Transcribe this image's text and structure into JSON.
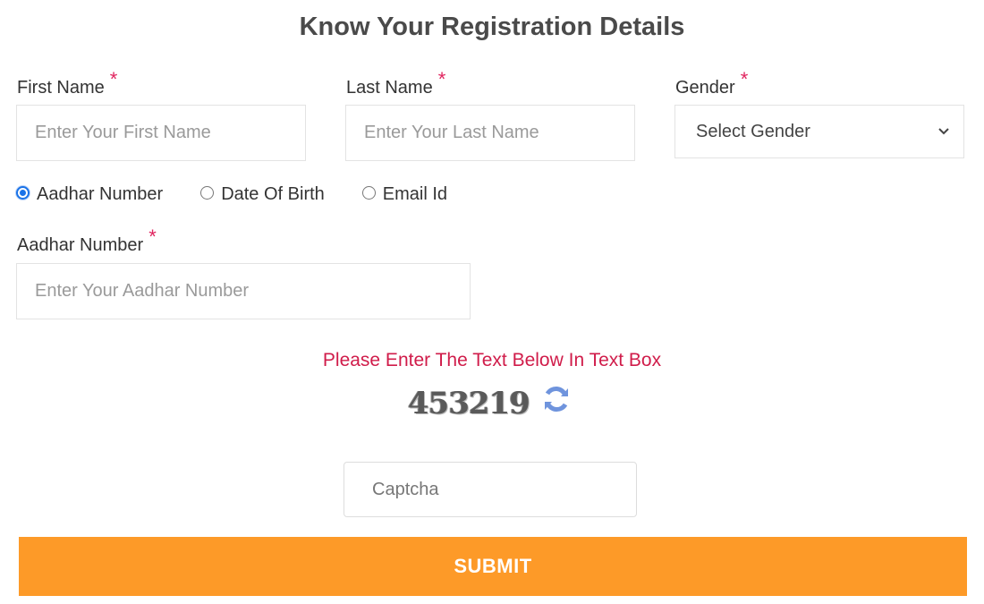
{
  "title": "Know Your Registration Details",
  "form": {
    "first_name": {
      "label": "First Name",
      "required_mark": "*",
      "value": "",
      "placeholder": "Enter Your First Name"
    },
    "last_name": {
      "label": "Last Name",
      "required_mark": "*",
      "value": "",
      "placeholder": "Enter Your Last Name"
    },
    "gender": {
      "label": "Gender",
      "required_mark": "*",
      "selected": "Select Gender"
    },
    "search_by": {
      "options": [
        {
          "label": "Aadhar Number",
          "checked": true
        },
        {
          "label": "Date Of Birth",
          "checked": false
        },
        {
          "label": "Email Id",
          "checked": false
        }
      ]
    },
    "aadhar": {
      "label": "Aadhar Number",
      "required_mark": "*",
      "value": "",
      "placeholder": "Enter Your Aadhar Number"
    },
    "captcha": {
      "prompt": "Please Enter The Text Below In Text Box",
      "code": "453219",
      "refresh_icon": "refresh-icon",
      "value": "",
      "placeholder": "Captcha"
    },
    "submit_label": "SUBMIT"
  },
  "colors": {
    "accent_orange": "#fd9a28",
    "required_red": "#e0245e",
    "prompt_red": "#d01c4a",
    "radio_blue": "#1a73e8",
    "refresh_blue": "#6f94dd"
  }
}
